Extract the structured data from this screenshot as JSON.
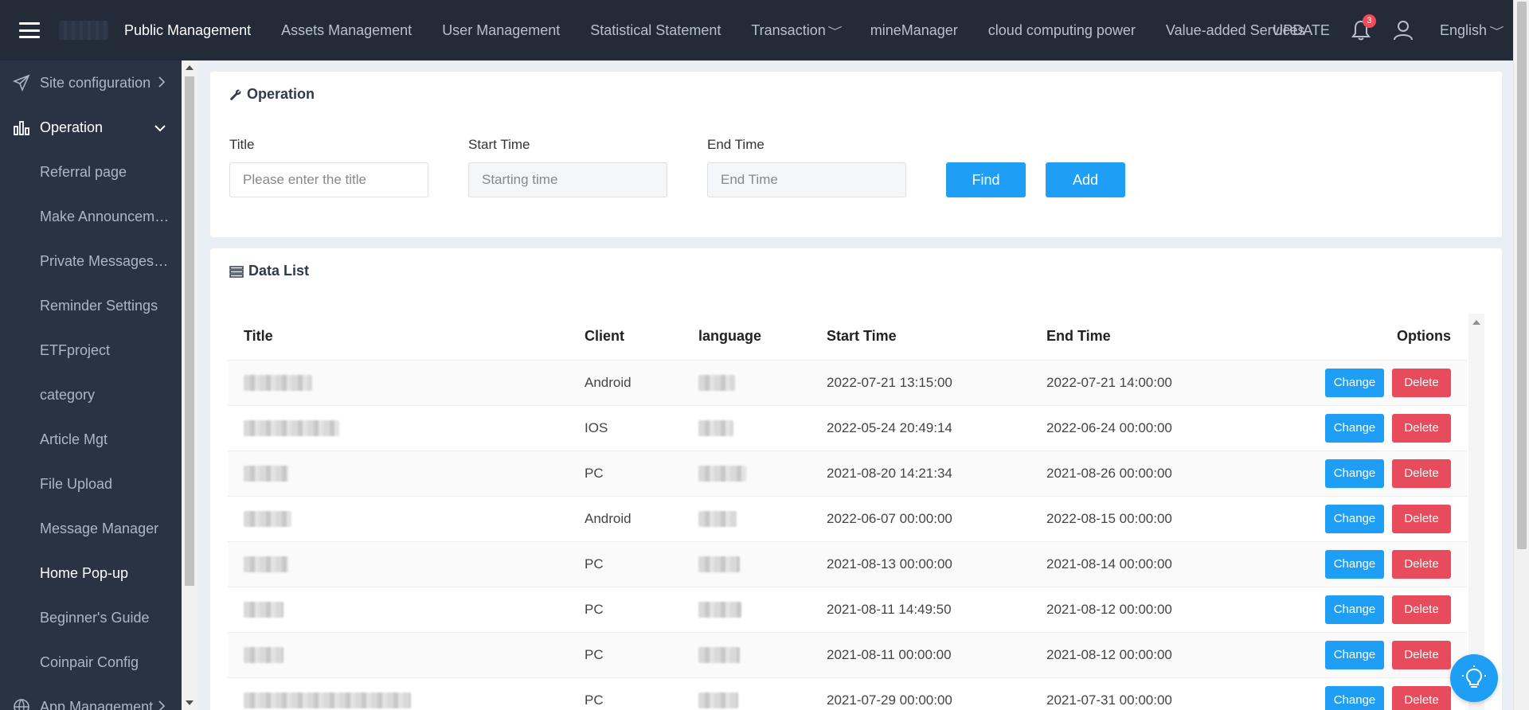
{
  "topbar": {
    "nav_items": [
      {
        "label": "Public Management",
        "active": true
      },
      {
        "label": "Assets Management"
      },
      {
        "label": "User Management"
      },
      {
        "label": "Statistical Statement"
      },
      {
        "label": "Transaction",
        "dropdown": true
      },
      {
        "label": "mineManager"
      },
      {
        "label": "cloud computing power"
      },
      {
        "label": "Value-added Services"
      }
    ],
    "update_label": "UPDATE",
    "notification_count": "3",
    "language": "English"
  },
  "sidebar": {
    "items": [
      {
        "label": "Site configuration",
        "icon": "send-icon",
        "parent": true,
        "arrow": ">"
      },
      {
        "label": "Operation",
        "icon": "chart-bar-icon",
        "parent": true,
        "open": true
      },
      {
        "label": "Referral page"
      },
      {
        "label": "Make Announcement"
      },
      {
        "label": "Private Messages M..."
      },
      {
        "label": "Reminder Settings"
      },
      {
        "label": "ETFproject"
      },
      {
        "label": "category"
      },
      {
        "label": "Article Mgt"
      },
      {
        "label": "File Upload"
      },
      {
        "label": "Message Manager"
      },
      {
        "label": "Home Pop-up",
        "active": true
      },
      {
        "label": "Beginner's Guide"
      },
      {
        "label": "Coinpair Config"
      },
      {
        "label": "App Management",
        "icon": "globe-icon",
        "parent": true,
        "arrow": ">"
      }
    ]
  },
  "operation": {
    "title": "Operation",
    "fields": {
      "title_label": "Title",
      "title_placeholder": "Please enter the title",
      "start_label": "Start Time",
      "start_placeholder": "Starting time",
      "end_label": "End Time",
      "end_placeholder": "End Time"
    },
    "find_label": "Find",
    "add_label": "Add"
  },
  "data_list": {
    "title": "Data List",
    "columns": [
      "Title",
      "Client",
      "language",
      "Start Time",
      "End Time",
      "Options"
    ],
    "change_label": "Change",
    "delete_label": "Delete",
    "rows": [
      {
        "client": "Android",
        "start": "2022-07-21 13:15:00",
        "end": "2022-07-21 14:00:00"
      },
      {
        "client": "IOS",
        "start": "2022-05-24 20:49:14",
        "end": "2022-06-24 00:00:00"
      },
      {
        "client": "PC",
        "start": "2021-08-20 14:21:34",
        "end": "2021-08-26 00:00:00"
      },
      {
        "client": "Android",
        "start": "2022-06-07 00:00:00",
        "end": "2022-08-15 00:00:00"
      },
      {
        "client": "PC",
        "start": "2021-08-13 00:00:00",
        "end": "2021-08-14 00:00:00"
      },
      {
        "client": "PC",
        "start": "2021-08-11 14:49:50",
        "end": "2021-08-12 00:00:00"
      },
      {
        "client": "PC",
        "start": "2021-08-11 00:00:00",
        "end": "2021-08-12 00:00:00"
      },
      {
        "client": "PC",
        "start": "2021-07-29 00:00:00",
        "end": "2021-07-31 00:00:00"
      }
    ]
  },
  "colors": {
    "topbar_bg": "#232b38",
    "sidebar_bg": "#2a3343",
    "primary": "#1e9ef5",
    "danger": "#e84c5c"
  }
}
